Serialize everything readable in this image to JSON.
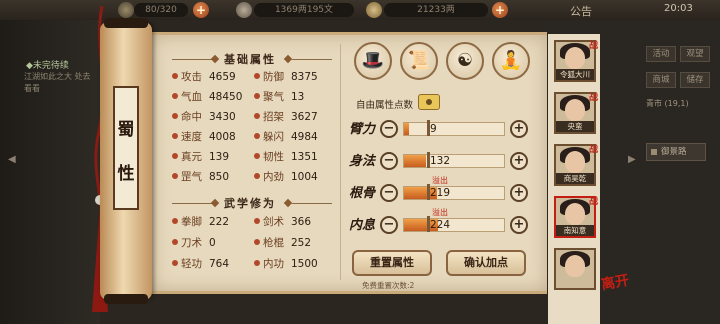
{
  "topbar": {
    "stamina": "80/320",
    "copper": "1369两195文",
    "silver": "21233两",
    "notice": "公告",
    "time": "20:03"
  },
  "quest": {
    "title": "◆未完待续",
    "body": "江湖如此之大 处去看看"
  },
  "scroll_label": "蜀\n性",
  "basic_attrs": {
    "header": "基础属性",
    "items": [
      {
        "label": "攻击",
        "value": "4659"
      },
      {
        "label": "防御",
        "value": "8375"
      },
      {
        "label": "气血",
        "value": "48450"
      },
      {
        "label": "聚气",
        "value": "13"
      },
      {
        "label": "命中",
        "value": "3430"
      },
      {
        "label": "招架",
        "value": "3627"
      },
      {
        "label": "速度",
        "value": "4008"
      },
      {
        "label": "躲闪",
        "value": "4984"
      },
      {
        "label": "真元",
        "value": "139"
      },
      {
        "label": "韧性",
        "value": "1351"
      },
      {
        "label": "罡气",
        "value": "850"
      },
      {
        "label": "内劲",
        "value": "1004"
      }
    ]
  },
  "martial_attrs": {
    "header": "武学修为",
    "items": [
      {
        "label": "拳脚",
        "value": "222"
      },
      {
        "label": "剑术",
        "value": "366"
      },
      {
        "label": "刀术",
        "value": "0"
      },
      {
        "label": "枪棍",
        "value": "252"
      },
      {
        "label": "轻功",
        "value": "764"
      },
      {
        "label": "内功",
        "value": "1500"
      }
    ]
  },
  "tabs": [
    {
      "icon": "hero-hat-icon"
    },
    {
      "icon": "scroll-book-icon"
    },
    {
      "icon": "yin-yang-icon"
    },
    {
      "icon": "martial-pose-icon"
    }
  ],
  "free_points_label": "自由属性点数",
  "stat_rows": [
    {
      "calligraphy": "臂力",
      "value": "9",
      "fill": 0.05,
      "overflow": ""
    },
    {
      "calligraphy": "身法",
      "value": "132",
      "fill": 0.22,
      "overflow": ""
    },
    {
      "calligraphy": "根骨",
      "value": "219",
      "fill": 0.33,
      "overflow": "溢出"
    },
    {
      "calligraphy": "内息",
      "value": "224",
      "fill": 0.34,
      "overflow": "溢出"
    }
  ],
  "buttons": {
    "reset": "重置属性",
    "confirm": "确认加点",
    "free_reset": "免费重置次数:2"
  },
  "roster": [
    {
      "name": "令狐大川",
      "war": "战",
      "selected": false
    },
    {
      "name": "央蛮",
      "war": "战",
      "selected": false
    },
    {
      "name": "商昊乾",
      "war": "战",
      "selected": false
    },
    {
      "name": "南知意",
      "war": "战",
      "selected": true
    },
    {
      "name": "",
      "war": "",
      "selected": false
    }
  ],
  "leave_label": "离开",
  "side_menu": {
    "row1": [
      "活动",
      "观望"
    ],
    "row2": [
      "商城",
      "储存"
    ],
    "map_text": "青市 (19,1)",
    "road": "御景路"
  },
  "colors": {
    "accent_red": "#c21e14",
    "bar_orange": "#e07a2e",
    "parchment": "#e7d9bd"
  }
}
